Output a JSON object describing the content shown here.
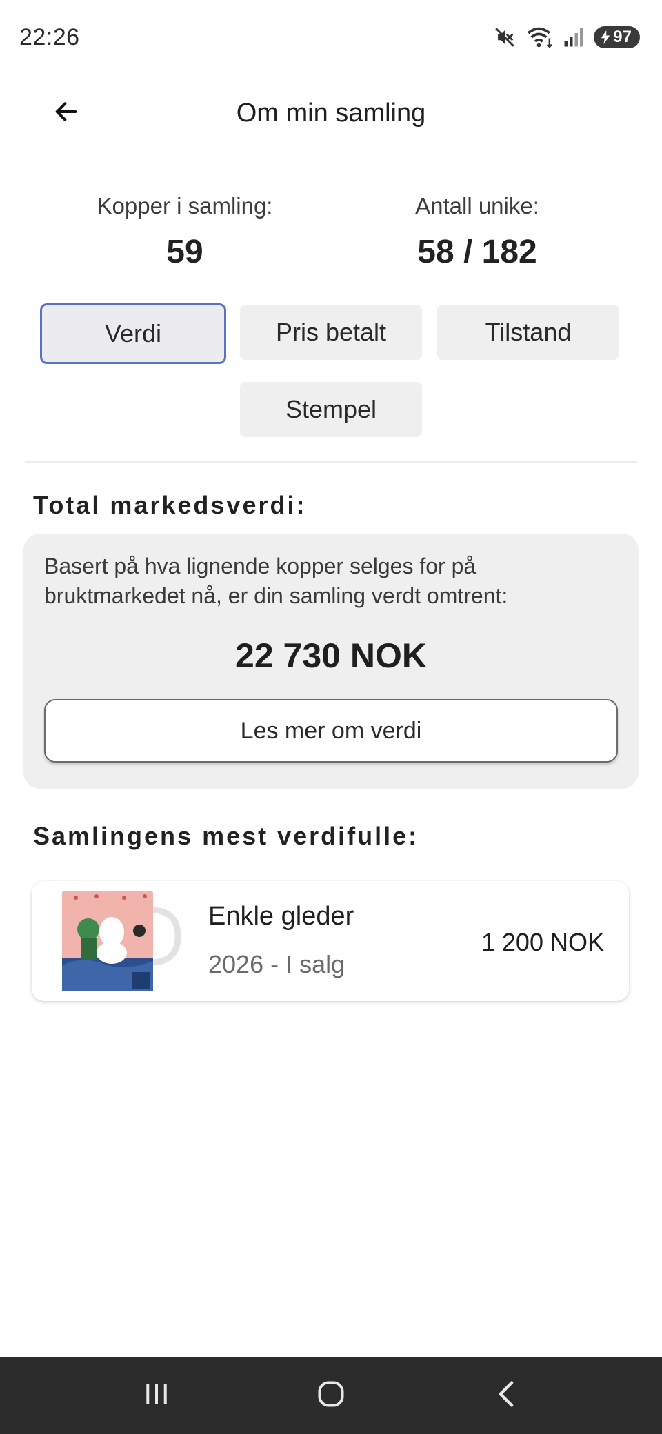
{
  "status_bar": {
    "time": "22:26",
    "battery": "97",
    "icons": [
      "mute-icon",
      "wifi-icon",
      "signal-icon",
      "battery-charging-icon"
    ]
  },
  "header": {
    "title": "Om min samling",
    "back_icon": "arrow-left-icon"
  },
  "stats": {
    "cups_label": "Kopper i samling:",
    "cups_value": "59",
    "unique_label": "Antall unike:",
    "unique_value": "58 / 182"
  },
  "tabs": [
    {
      "label": "Verdi",
      "active": true
    },
    {
      "label": "Pris betalt",
      "active": false
    },
    {
      "label": "Tilstand",
      "active": false
    },
    {
      "label": "Stempel",
      "active": false
    }
  ],
  "total": {
    "title": "Total markedsverdi:",
    "description": "Basert på hva lignende kopper selges for på bruktmarkedet nå, er din samling verdt omtrent:",
    "amount": "22 730 NOK",
    "read_more": "Les mer om verdi"
  },
  "valuable": {
    "title": "Samlingens mest verdifulle:",
    "items": [
      {
        "name": "Enkle gleder",
        "meta": "2026 - I salg",
        "price": "1 200 NOK"
      }
    ]
  },
  "colors": {
    "active_tab_border": "#5a72c4",
    "tab_background": "#efefef",
    "card_background": "#efefef",
    "nav_bar": "#2c2c2c"
  },
  "nav": {
    "recents_icon": "recents-icon",
    "home_icon": "home-icon",
    "back_icon": "chevron-left-icon"
  }
}
